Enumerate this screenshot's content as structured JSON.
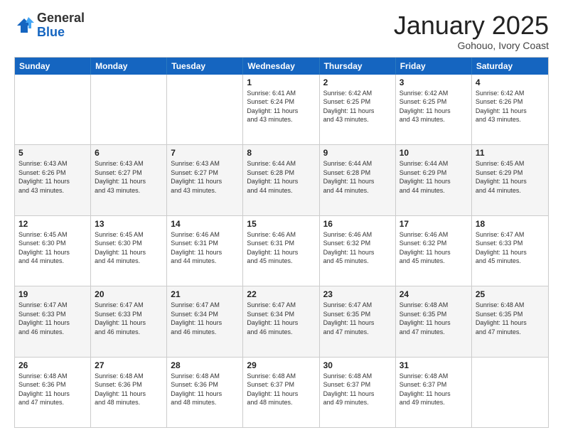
{
  "header": {
    "logo_general": "General",
    "logo_blue": "Blue",
    "month_title": "January 2025",
    "location": "Gohouo, Ivory Coast"
  },
  "weekdays": [
    "Sunday",
    "Monday",
    "Tuesday",
    "Wednesday",
    "Thursday",
    "Friday",
    "Saturday"
  ],
  "rows": [
    {
      "alt": false,
      "cells": [
        {
          "day": "",
          "text": ""
        },
        {
          "day": "",
          "text": ""
        },
        {
          "day": "",
          "text": ""
        },
        {
          "day": "1",
          "text": "Sunrise: 6:41 AM\nSunset: 6:24 PM\nDaylight: 11 hours\nand 43 minutes."
        },
        {
          "day": "2",
          "text": "Sunrise: 6:42 AM\nSunset: 6:25 PM\nDaylight: 11 hours\nand 43 minutes."
        },
        {
          "day": "3",
          "text": "Sunrise: 6:42 AM\nSunset: 6:25 PM\nDaylight: 11 hours\nand 43 minutes."
        },
        {
          "day": "4",
          "text": "Sunrise: 6:42 AM\nSunset: 6:26 PM\nDaylight: 11 hours\nand 43 minutes."
        }
      ]
    },
    {
      "alt": true,
      "cells": [
        {
          "day": "5",
          "text": "Sunrise: 6:43 AM\nSunset: 6:26 PM\nDaylight: 11 hours\nand 43 minutes."
        },
        {
          "day": "6",
          "text": "Sunrise: 6:43 AM\nSunset: 6:27 PM\nDaylight: 11 hours\nand 43 minutes."
        },
        {
          "day": "7",
          "text": "Sunrise: 6:43 AM\nSunset: 6:27 PM\nDaylight: 11 hours\nand 43 minutes."
        },
        {
          "day": "8",
          "text": "Sunrise: 6:44 AM\nSunset: 6:28 PM\nDaylight: 11 hours\nand 44 minutes."
        },
        {
          "day": "9",
          "text": "Sunrise: 6:44 AM\nSunset: 6:28 PM\nDaylight: 11 hours\nand 44 minutes."
        },
        {
          "day": "10",
          "text": "Sunrise: 6:44 AM\nSunset: 6:29 PM\nDaylight: 11 hours\nand 44 minutes."
        },
        {
          "day": "11",
          "text": "Sunrise: 6:45 AM\nSunset: 6:29 PM\nDaylight: 11 hours\nand 44 minutes."
        }
      ]
    },
    {
      "alt": false,
      "cells": [
        {
          "day": "12",
          "text": "Sunrise: 6:45 AM\nSunset: 6:30 PM\nDaylight: 11 hours\nand 44 minutes."
        },
        {
          "day": "13",
          "text": "Sunrise: 6:45 AM\nSunset: 6:30 PM\nDaylight: 11 hours\nand 44 minutes."
        },
        {
          "day": "14",
          "text": "Sunrise: 6:46 AM\nSunset: 6:31 PM\nDaylight: 11 hours\nand 44 minutes."
        },
        {
          "day": "15",
          "text": "Sunrise: 6:46 AM\nSunset: 6:31 PM\nDaylight: 11 hours\nand 45 minutes."
        },
        {
          "day": "16",
          "text": "Sunrise: 6:46 AM\nSunset: 6:32 PM\nDaylight: 11 hours\nand 45 minutes."
        },
        {
          "day": "17",
          "text": "Sunrise: 6:46 AM\nSunset: 6:32 PM\nDaylight: 11 hours\nand 45 minutes."
        },
        {
          "day": "18",
          "text": "Sunrise: 6:47 AM\nSunset: 6:33 PM\nDaylight: 11 hours\nand 45 minutes."
        }
      ]
    },
    {
      "alt": true,
      "cells": [
        {
          "day": "19",
          "text": "Sunrise: 6:47 AM\nSunset: 6:33 PM\nDaylight: 11 hours\nand 46 minutes."
        },
        {
          "day": "20",
          "text": "Sunrise: 6:47 AM\nSunset: 6:33 PM\nDaylight: 11 hours\nand 46 minutes."
        },
        {
          "day": "21",
          "text": "Sunrise: 6:47 AM\nSunset: 6:34 PM\nDaylight: 11 hours\nand 46 minutes."
        },
        {
          "day": "22",
          "text": "Sunrise: 6:47 AM\nSunset: 6:34 PM\nDaylight: 11 hours\nand 46 minutes."
        },
        {
          "day": "23",
          "text": "Sunrise: 6:47 AM\nSunset: 6:35 PM\nDaylight: 11 hours\nand 47 minutes."
        },
        {
          "day": "24",
          "text": "Sunrise: 6:48 AM\nSunset: 6:35 PM\nDaylight: 11 hours\nand 47 minutes."
        },
        {
          "day": "25",
          "text": "Sunrise: 6:48 AM\nSunset: 6:35 PM\nDaylight: 11 hours\nand 47 minutes."
        }
      ]
    },
    {
      "alt": false,
      "cells": [
        {
          "day": "26",
          "text": "Sunrise: 6:48 AM\nSunset: 6:36 PM\nDaylight: 11 hours\nand 47 minutes."
        },
        {
          "day": "27",
          "text": "Sunrise: 6:48 AM\nSunset: 6:36 PM\nDaylight: 11 hours\nand 48 minutes."
        },
        {
          "day": "28",
          "text": "Sunrise: 6:48 AM\nSunset: 6:36 PM\nDaylight: 11 hours\nand 48 minutes."
        },
        {
          "day": "29",
          "text": "Sunrise: 6:48 AM\nSunset: 6:37 PM\nDaylight: 11 hours\nand 48 minutes."
        },
        {
          "day": "30",
          "text": "Sunrise: 6:48 AM\nSunset: 6:37 PM\nDaylight: 11 hours\nand 49 minutes."
        },
        {
          "day": "31",
          "text": "Sunrise: 6:48 AM\nSunset: 6:37 PM\nDaylight: 11 hours\nand 49 minutes."
        },
        {
          "day": "",
          "text": ""
        }
      ]
    }
  ]
}
